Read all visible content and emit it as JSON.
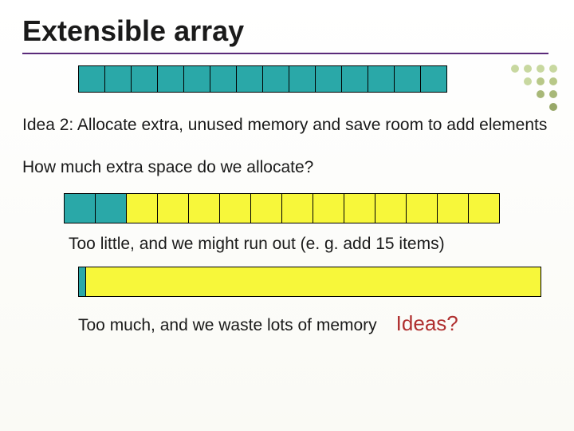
{
  "title": "Extensible array",
  "idea": "Idea 2: Allocate extra, unused memory and save room to add elements",
  "question": "How much extra space do we allocate?",
  "caption_little": "Too little, and we might run out (e. g. add 15 items)",
  "caption_much": "Too much, and we waste lots of memory",
  "ideas_prompt": "Ideas?",
  "arrays": {
    "top": {
      "filled": 14,
      "empty": 0
    },
    "middle": {
      "filled": 2,
      "empty": 12
    },
    "bottom": {
      "filled": 1,
      "empty_wide": true
    }
  },
  "colors": {
    "filled": "#2aa8a8",
    "empty": "#f7f73a",
    "accent": "#b03030",
    "underline": "#5a2a7a"
  }
}
